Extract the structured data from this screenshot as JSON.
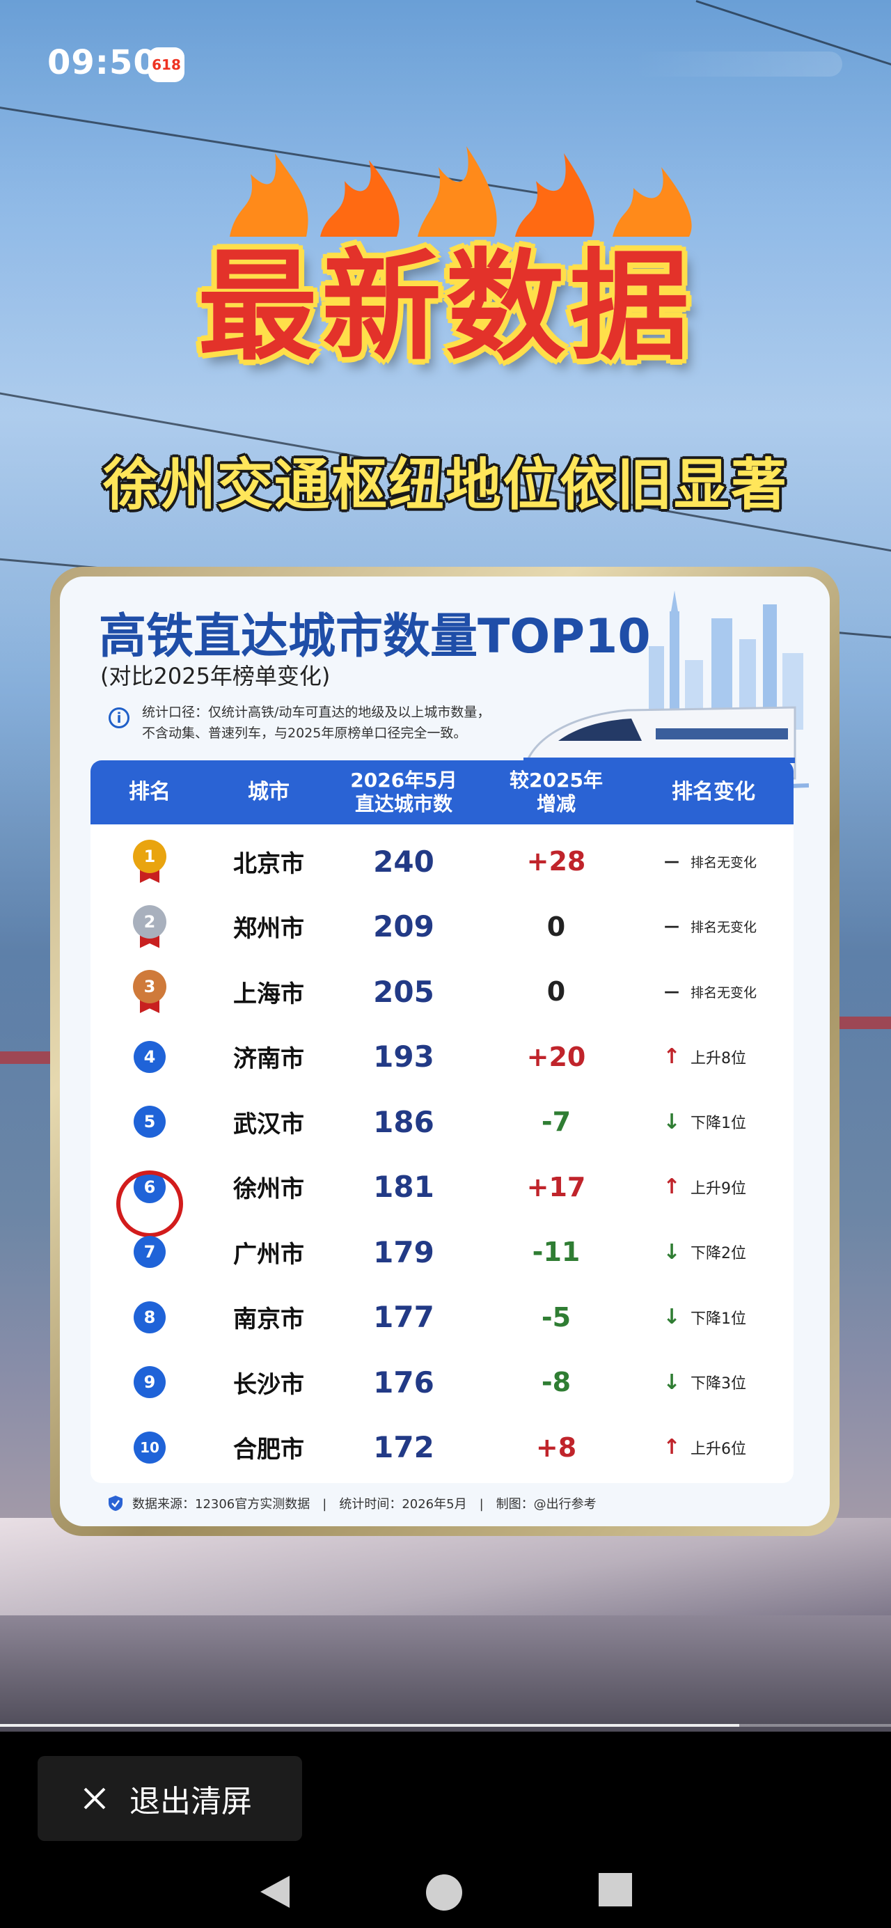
{
  "status_bar": {
    "time": "09:50",
    "app_badge": "618"
  },
  "video": {
    "headline": "最新数据",
    "subheadline": "徐州交通枢纽地位依旧显著"
  },
  "card": {
    "title": "高铁直达城市数量TOP10",
    "subtitle": "(对比2025年榜单变化)",
    "note_line1": "统计口径：仅统计高铁/动车可直达的地级及以上城市数量，",
    "note_line2": "不含动集、普速列车，与2025年原榜单口径完全一致。",
    "headers": {
      "rank": "排名",
      "city": "城市",
      "count_line1": "2026年5月",
      "count_line2": "直达城市数",
      "delta_line1": "较2025年",
      "delta_line2": "增减",
      "change": "排名变化"
    },
    "rows": [
      {
        "rank": "1",
        "city": "北京市",
        "count": "240",
        "delta": "+28",
        "change": "排名无变化",
        "trend": "same"
      },
      {
        "rank": "2",
        "city": "郑州市",
        "count": "209",
        "delta": "0",
        "change": "排名无变化",
        "trend": "same"
      },
      {
        "rank": "3",
        "city": "上海市",
        "count": "205",
        "delta": "0",
        "change": "排名无变化",
        "trend": "same"
      },
      {
        "rank": "4",
        "city": "济南市",
        "count": "193",
        "delta": "+20",
        "change": "上升8位",
        "trend": "up"
      },
      {
        "rank": "5",
        "city": "武汉市",
        "count": "186",
        "delta": "-7",
        "change": "下降1位",
        "trend": "down"
      },
      {
        "rank": "6",
        "city": "徐州市",
        "count": "181",
        "delta": "+17",
        "change": "上升9位",
        "trend": "up"
      },
      {
        "rank": "7",
        "city": "广州市",
        "count": "179",
        "delta": "-11",
        "change": "下降2位",
        "trend": "down"
      },
      {
        "rank": "8",
        "city": "南京市",
        "count": "177",
        "delta": "-5",
        "change": "下降1位",
        "trend": "down"
      },
      {
        "rank": "9",
        "city": "长沙市",
        "count": "176",
        "delta": "-8",
        "change": "下降3位",
        "trend": "down"
      },
      {
        "rank": "10",
        "city": "合肥市",
        "count": "172",
        "delta": "+8",
        "change": "上升6位",
        "trend": "up"
      }
    ],
    "footer": "数据来源：12306官方实测数据　|　统计时间：2026年5月　|　制图：@出行参考"
  },
  "exit_button": {
    "label": "退出清屏"
  },
  "colors": {
    "up": "#c0242b",
    "down": "#2f7d33",
    "accent": "#2a63d4"
  }
}
